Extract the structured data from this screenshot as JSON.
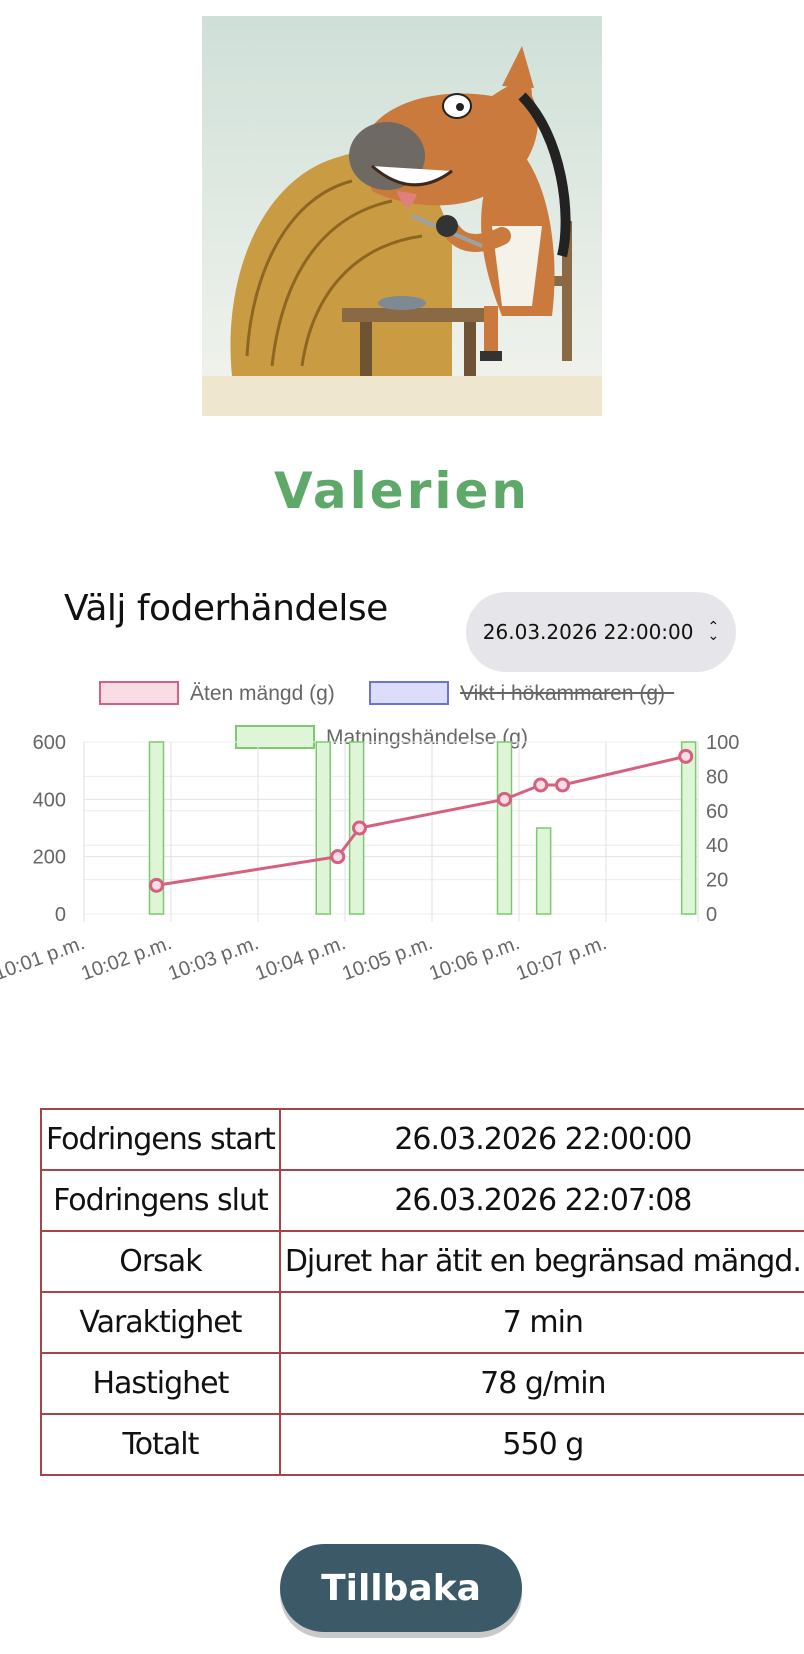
{
  "animal": {
    "name": "Valerien",
    "image_alt": "horse-eating-hay-illustration"
  },
  "selector": {
    "label": "Välj foderhändelse",
    "selected": "26.03.2026 22:00:00"
  },
  "chart_data": {
    "type": "bar+line",
    "legend": [
      {
        "label": "Äten mängd (g)",
        "fill": "#f9dde6",
        "stroke": "#d5607f",
        "hidden": false
      },
      {
        "label": "Vikt i hökammaren (g)",
        "fill": "#dcdcfb",
        "stroke": "#6c73d6",
        "hidden": true
      },
      {
        "label": "Matningshändelse (g)",
        "fill": "#dff5d7",
        "stroke": "#7dc870",
        "hidden": false
      }
    ],
    "x_ticks": [
      "10:01 p.m.",
      "10:02 p.m.",
      "10:03 p.m.",
      "10:04 p.m.",
      "10:05 p.m.",
      "10:06 p.m.",
      "10:07 p.m."
    ],
    "y_left": {
      "range": [
        0,
        600
      ],
      "ticks": [
        "0",
        "200",
        "400",
        "600"
      ]
    },
    "y_right": {
      "range": [
        0,
        100
      ],
      "ticks": [
        "0",
        "20",
        "40",
        "60",
        "80",
        "100"
      ]
    },
    "series": [
      {
        "name": "Äten mängd (g)",
        "type": "line",
        "axis": "left",
        "color": "#d5607f",
        "points": [
          [
            "22:01:30",
            100
          ],
          [
            "22:03:35",
            200
          ],
          [
            "22:03:50",
            300
          ],
          [
            "22:05:30",
            400
          ],
          [
            "22:05:55",
            450
          ],
          [
            "22:06:10",
            450
          ],
          [
            "22:07:35",
            550
          ]
        ]
      },
      {
        "name": "Matningshändelse (g)",
        "type": "bar",
        "axis": "right",
        "color": "#7dc870",
        "points": [
          [
            "22:01:30",
            100
          ],
          [
            "22:03:25",
            100
          ],
          [
            "22:03:48",
            100
          ],
          [
            "22:05:30",
            100
          ],
          [
            "22:05:57",
            50
          ],
          [
            "22:07:37",
            100
          ]
        ]
      }
    ],
    "grid": true
  },
  "details": [
    {
      "key": "Fodringens start",
      "value": "26.03.2026 22:00:00"
    },
    {
      "key": "Fodringens slut",
      "value": "26.03.2026 22:07:08"
    },
    {
      "key": "Orsak",
      "value": "Djuret har ätit en begränsad mängd."
    },
    {
      "key": "Varaktighet",
      "value": "7 min"
    },
    {
      "key": "Hastighet",
      "value": "78 g/min"
    },
    {
      "key": "Totalt",
      "value": "550 g"
    }
  ],
  "back_button": {
    "label": "Tillbaka"
  }
}
